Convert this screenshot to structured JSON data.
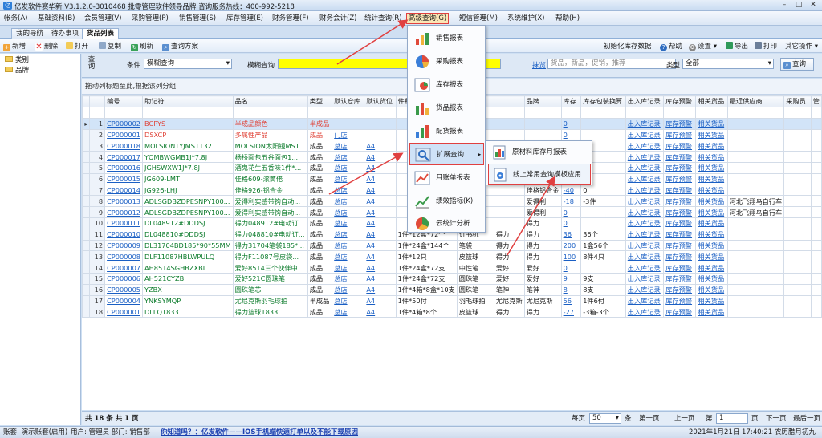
{
  "window": {
    "title": "亿发软件赛华新 V3.1.2.0-3010468 批零管理软件领导品牌 咨询服务热线：400-992-5218",
    "min": "–",
    "max": "□",
    "close": "✕"
  },
  "menus": [
    "帐务(A)",
    "基础资料(B)",
    "会员管理(V)",
    "采购管理(P)",
    "销售管理(S)",
    "库存管理(E)",
    "财务管理(F)",
    "财务会计(Z)",
    "统计查询(R)",
    "高级查询(G)",
    "短信管理(M)",
    "系统维护(X)",
    "帮助(H)"
  ],
  "tabs": [
    "我的导航",
    "待办事项",
    "货品列表"
  ],
  "toolbar": {
    "new": "新增",
    "delete": "删除",
    "open": "打开",
    "copy": "复制",
    "refresh": "刷新",
    "query_plan": "查询方案",
    "init_stock": "初始化库存数据",
    "help": "帮助",
    "settings": "设置",
    "export": "导出",
    "print": "打印",
    "other": "其它操作"
  },
  "tree": {
    "categories": "类别",
    "brand": "品牌"
  },
  "query": {
    "label": "查询",
    "condition_label": "条件",
    "condition_value": "模糊查询",
    "fuzzy_label": "模糊查询",
    "hint_link": "抹览",
    "placeholder": "货品，新品，促销，推荐",
    "type_label": "类型",
    "type_value": "全部",
    "search_button": "查询"
  },
  "group_hint": "拖动列标题至此,根据该列分组",
  "columns": [
    "编号",
    "助记符",
    "品名",
    "类型",
    "默认仓库",
    "默认货位",
    "件积",
    "",
    "",
    "品牌",
    "库存",
    "库存包装换算",
    "出入库记录",
    "库存预警",
    "相关货品",
    "最近供应商",
    "采购员",
    "管"
  ],
  "rows": [
    {
      "n": "1",
      "code": "CP000002",
      "mnemonic": "BCPYS",
      "name": "半成品颜色",
      "type": "半成品",
      "wh": "",
      "loc": "",
      "vol": "",
      "c8": "",
      "c9": "",
      "brand": "",
      "stock": "0",
      "pack": "",
      "io": "出入库记录",
      "warn": "库存预警",
      "rel": "相关货品",
      "sup": "",
      "buyer": "",
      "style": "red"
    },
    {
      "n": "2",
      "code": "CP000001",
      "mnemonic": "DSXCP",
      "name": "多属性产品",
      "type": "成品",
      "wh": "门店",
      "loc": "",
      "vol": "",
      "c8": "",
      "c9": "",
      "brand": "",
      "stock": "0",
      "pack": "",
      "io": "出入库记录",
      "warn": "库存预警",
      "rel": "相关货品",
      "sup": "",
      "buyer": "",
      "style": "red"
    },
    {
      "n": "3",
      "code": "CP000018",
      "mnemonic": "MOLSIONTYJMS1132",
      "name": "MOLSION太阳镜MS1...",
      "type": "成品",
      "wh": "总店",
      "loc": "A4",
      "vol": "",
      "c8": "",
      "c9": "",
      "brand": "",
      "stock": "0",
      "pack": "",
      "io": "出入库记录",
      "warn": "库存预警",
      "rel": "相关货品",
      "sup": "",
      "buyer": "",
      "style": ""
    },
    {
      "n": "4",
      "code": "CP000017",
      "mnemonic": "YQMBWGMB1J*7.8J",
      "name": "杨桥面包五谷面包1...",
      "type": "成品",
      "wh": "总店",
      "loc": "A4",
      "vol": "",
      "c8": "",
      "c9": "",
      "brand": "",
      "stock": "0",
      "pack": "",
      "io": "出入库记录",
      "warn": "库存预警",
      "rel": "相关货品",
      "sup": "",
      "buyer": "",
      "style": ""
    },
    {
      "n": "5",
      "code": "CP000016",
      "mnemonic": "JGHSWXW1J*7.8J",
      "name": "酒鬼花生五香味1件*...",
      "type": "成品",
      "wh": "总店",
      "loc": "A4",
      "vol": "",
      "c8": "",
      "c9": "",
      "brand": "",
      "stock": "0",
      "pack": "",
      "io": "出入库记录",
      "warn": "库存预警",
      "rel": "相关货品",
      "sup": "",
      "buyer": "",
      "style": ""
    },
    {
      "n": "6",
      "code": "CP000015",
      "mnemonic": "JG609-LMT",
      "name": "佳格609-滚筒佬",
      "type": "成品",
      "wh": "总店",
      "loc": "A4",
      "vol": "",
      "c8": "",
      "c9": "",
      "brand": "",
      "stock": "0",
      "pack": "",
      "io": "出入库记录",
      "warn": "库存预警",
      "rel": "相关货品",
      "sup": "",
      "buyer": "",
      "style": ""
    },
    {
      "n": "7",
      "code": "CP000014",
      "mnemonic": "JG926-LHJ",
      "name": "佳格926-铝合金",
      "type": "成品",
      "wh": "总店",
      "loc": "A4",
      "vol": "",
      "c8": "",
      "c9": "",
      "brand": "佳格铝合金",
      "stock": "-40",
      "pack": "0",
      "io": "出入库记录",
      "warn": "库存预警",
      "rel": "相关货品",
      "sup": "",
      "buyer": "",
      "style": ""
    },
    {
      "n": "8",
      "code": "CP000013",
      "mnemonic": "ADLSGDBZDPESNPY100...",
      "name": "爱得利实感带钩自动...",
      "type": "成品",
      "wh": "总店",
      "loc": "A4",
      "vol": "",
      "c8": "",
      "c9": "",
      "brand": "爱得利",
      "stock": "-18",
      "pack": "-3件",
      "io": "出入库记录",
      "warn": "库存预警",
      "rel": "相关货品",
      "sup": "河北飞翔鸟自行车",
      "buyer": "",
      "style": ""
    },
    {
      "n": "9",
      "code": "CP000012",
      "mnemonic": "ADLSGDBZDPESNPY100...",
      "name": "爱得利实感带钩自动...",
      "type": "成品",
      "wh": "总店",
      "loc": "A4",
      "vol": "",
      "c8": "",
      "c9": "",
      "brand": "爱得利",
      "stock": "0",
      "pack": "",
      "io": "出入库记录",
      "warn": "库存预警",
      "rel": "相关货品",
      "sup": "河北飞翔鸟自行车",
      "buyer": "",
      "style": ""
    },
    {
      "n": "10",
      "code": "CP000011",
      "mnemonic": "DL048912#DDDSJ",
      "name": "得力048912#电动订...",
      "type": "成品",
      "wh": "总店",
      "loc": "A4",
      "vol": "",
      "c8": "",
      "c9": "",
      "brand": "得力",
      "stock": "0",
      "pack": "",
      "io": "出入库记录",
      "warn": "库存预警",
      "rel": "相关货品",
      "sup": "",
      "buyer": "",
      "style": ""
    },
    {
      "n": "11",
      "code": "CP000010",
      "mnemonic": "DL048810#DDDSJ",
      "name": "得力048810#电动订...",
      "type": "成品",
      "wh": "总店",
      "loc": "A4",
      "vol": "1件*12盒*72个",
      "c8": "订书机",
      "c9": "得力",
      "brand": "得力",
      "stock": "36",
      "pack": "36个",
      "io": "出入库记录",
      "warn": "库存预警",
      "rel": "相关货品",
      "sup": "",
      "buyer": "",
      "style": ""
    },
    {
      "n": "12",
      "code": "CP000009",
      "mnemonic": "DL31704BD185*90*55MM",
      "name": "得力31704笔袋185*...",
      "type": "成品",
      "wh": "总店",
      "loc": "A4",
      "vol": "1件*24盒*144个",
      "c8": "笔袋",
      "c9": "得力",
      "brand": "得力",
      "stock": "200",
      "pack": "1盒56个",
      "io": "出入库记录",
      "warn": "库存预警",
      "rel": "相关货品",
      "sup": "",
      "buyer": "",
      "style": ""
    },
    {
      "n": "13",
      "code": "CP000008",
      "mnemonic": "DLF11087HBLWPULQ",
      "name": "得力F11087号皮袋...",
      "type": "成品",
      "wh": "总店",
      "loc": "A4",
      "vol": "1件*12只",
      "c8": "皮篮球",
      "c9": "得力",
      "brand": "得力",
      "stock": "100",
      "pack": "8件4只",
      "io": "出入库记录",
      "warn": "库存预警",
      "rel": "相关货品",
      "sup": "",
      "buyer": "",
      "style": ""
    },
    {
      "n": "14",
      "code": "CP000007",
      "mnemonic": "AH8514SGHBZXBL",
      "name": "爱好8514三个伙伴中...",
      "type": "成品",
      "wh": "总店",
      "loc": "A4",
      "vol": "1件*24盒*72支",
      "c8": "中性笔",
      "c9": "爱好",
      "brand": "爱好",
      "stock": "0",
      "pack": "",
      "io": "出入库记录",
      "warn": "库存预警",
      "rel": "相关货品",
      "sup": "",
      "buyer": "",
      "style": ""
    },
    {
      "n": "15",
      "code": "CP000006",
      "mnemonic": "AH521CYZB",
      "name": "爱好521C圆珠笔",
      "type": "成品",
      "wh": "总店",
      "loc": "A4",
      "vol": "1件*24盒*72支",
      "c8": "圆珠笔",
      "c9": "爱好",
      "brand": "爱好",
      "stock": "9",
      "pack": "9支",
      "io": "出入库记录",
      "warn": "库存预警",
      "rel": "相关货品",
      "sup": "",
      "buyer": "",
      "style": ""
    },
    {
      "n": "16",
      "code": "CP000005",
      "mnemonic": "YZBX",
      "name": "圆珠笔芯",
      "type": "成品",
      "wh": "总店",
      "loc": "A4",
      "vol": "1件*4箱*8盒*10支",
      "c8": "圆珠笔",
      "c9": "笔神",
      "brand": "笔神",
      "stock": "8",
      "pack": "8支",
      "io": "出入库记录",
      "warn": "库存预警",
      "rel": "相关货品",
      "sup": "",
      "buyer": "",
      "style": ""
    },
    {
      "n": "17",
      "code": "CP000004",
      "mnemonic": "YNKSYMQP",
      "name": "尤尼克斯羽毛球拍",
      "type": "半成品",
      "wh": "总店",
      "loc": "A4",
      "vol": "1件*50付",
      "c8": "羽毛球拍",
      "c9": "尤尼克斯",
      "brand": "尤尼克斯",
      "stock": "56",
      "pack": "1件6付",
      "io": "出入库记录",
      "warn": "库存预警",
      "rel": "相关货品",
      "sup": "",
      "buyer": "",
      "style": ""
    },
    {
      "n": "18",
      "code": "CP000001",
      "mnemonic": "DLLQ1833",
      "name": "得力篮球1833",
      "type": "成品",
      "wh": "总店",
      "loc": "A4",
      "vol": "1件*4箱*8个",
      "c8": "皮篮球",
      "c9": "得力",
      "brand": "得力",
      "stock": "-27",
      "pack": "-3箱-3个",
      "io": "出入库记录",
      "warn": "库存预警",
      "rel": "相关货品",
      "sup": "",
      "buyer": "",
      "style": ""
    }
  ],
  "footer": {
    "summary": "共 18 条 共 1 页",
    "page_size_label": "每页",
    "page_size": "50",
    "unit": "条",
    "first": "第一页",
    "prev": "上一页",
    "page_label": "第",
    "page": "1",
    "page_unit": "页",
    "next": "下一页",
    "last": "最后一页"
  },
  "status": {
    "account": "账套: 演示账套(启用)",
    "user": "用户: 管理员 部门: 销售部",
    "promo": "你知道吗？：亿发软件——IOS手机端快速打单以及不能下载原因",
    "datetime": "2021年1月21日 17:40:21 农历腊月初九"
  },
  "dropdown": {
    "items": [
      "销售报表",
      "采购报表",
      "库存报表",
      "货品报表",
      "配货报表",
      "扩展查询",
      "月账单报表",
      "绩效指标(K)",
      "云统计分析"
    ]
  },
  "submenu": {
    "items": [
      "原材料库存月报表",
      "线上常用查询模板应用"
    ]
  },
  "colors": {
    "accent": "#e04040",
    "link": "#1a5fc4",
    "highlight_input": "#ffff00"
  }
}
